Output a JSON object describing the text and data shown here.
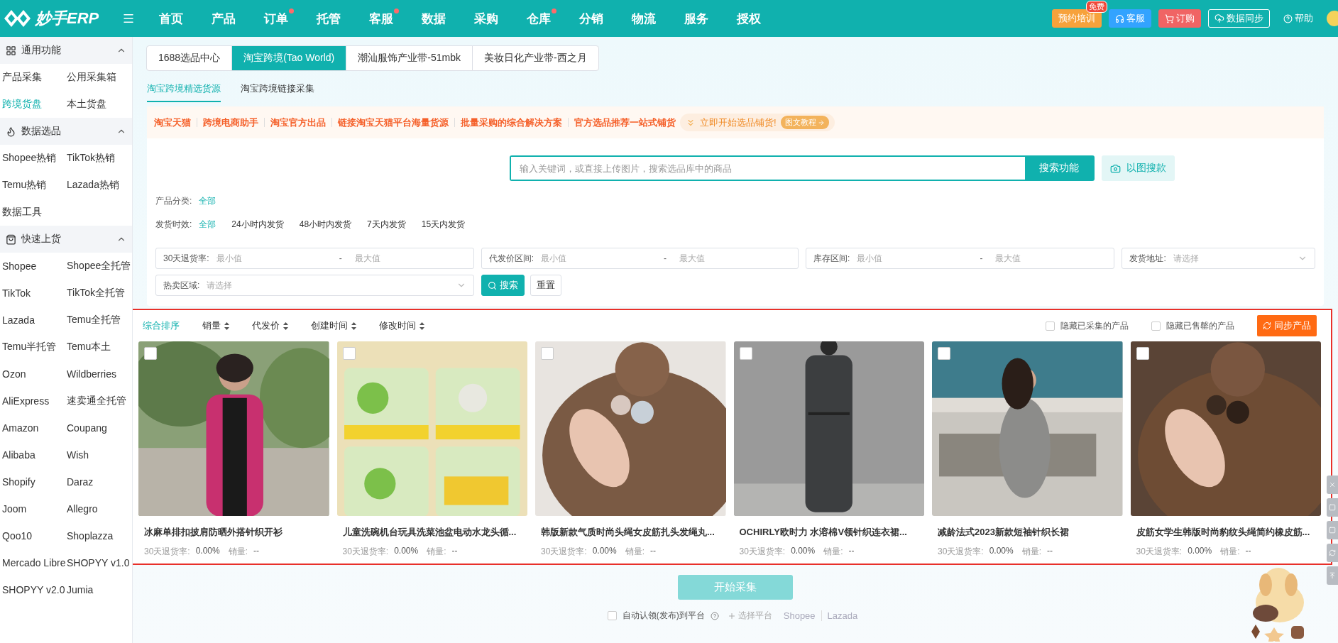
{
  "header": {
    "logo": "妙手ERP",
    "nav": [
      {
        "label": "首页",
        "dot": false
      },
      {
        "label": "产品",
        "dot": false
      },
      {
        "label": "订单",
        "dot": true
      },
      {
        "label": "托管",
        "dot": false
      },
      {
        "label": "客服",
        "dot": true
      },
      {
        "label": "数据",
        "dot": false
      },
      {
        "label": "采购",
        "dot": false
      },
      {
        "label": "仓库",
        "dot": true
      },
      {
        "label": "分销",
        "dot": false
      },
      {
        "label": "物流",
        "dot": false
      },
      {
        "label": "服务",
        "dot": false
      },
      {
        "label": "授权",
        "dot": false
      }
    ],
    "actions": [
      {
        "kind": "training",
        "label": "预约培训",
        "badge": "免费"
      },
      {
        "kind": "service",
        "label": "客服"
      },
      {
        "kind": "order",
        "label": "订购"
      },
      {
        "kind": "sync",
        "label": "数据同步"
      },
      {
        "kind": "help",
        "label": "帮助"
      }
    ]
  },
  "sidebar": {
    "sections": [
      {
        "kind": "grid",
        "title": "通用功能",
        "expanded": true,
        "items": [
          {
            "label": "产品采集",
            "selected": false
          },
          {
            "label": "公用采集箱",
            "selected": false
          },
          {
            "label": "跨境货盘",
            "selected": true
          },
          {
            "label": "本土货盘",
            "selected": false
          }
        ]
      },
      {
        "kind": "fire",
        "title": "数据选品",
        "expanded": true,
        "items": [
          {
            "label": "Shopee热销",
            "selected": false
          },
          {
            "label": "TikTok热销",
            "selected": false
          },
          {
            "label": "Temu热销",
            "selected": false
          },
          {
            "label": "Lazada热销",
            "selected": false
          },
          {
            "label": "数据工具",
            "selected": false
          }
        ]
      },
      {
        "kind": "bag",
        "title": "快速上货",
        "expanded": true,
        "items": [
          {
            "label": "Shopee",
            "selected": false
          },
          {
            "label": "Shopee全托管",
            "selected": false
          },
          {
            "label": "TikTok",
            "selected": false
          },
          {
            "label": "TikTok全托管",
            "selected": false
          },
          {
            "label": "Lazada",
            "selected": false
          },
          {
            "label": "Temu全托管",
            "selected": false
          },
          {
            "label": "Temu半托管",
            "selected": false
          },
          {
            "label": "Temu本土",
            "selected": false
          },
          {
            "label": "Ozon",
            "selected": false
          },
          {
            "label": "Wildberries",
            "selected": false
          },
          {
            "label": "AliExpress",
            "selected": false
          },
          {
            "label": "速卖通全托管",
            "selected": false
          },
          {
            "label": "Amazon",
            "selected": false
          },
          {
            "label": "Coupang",
            "selected": false
          },
          {
            "label": "Alibaba",
            "selected": false
          },
          {
            "label": "Wish",
            "selected": false
          },
          {
            "label": "Shopify",
            "selected": false
          },
          {
            "label": "Daraz",
            "selected": false
          },
          {
            "label": "Joom",
            "selected": false
          },
          {
            "label": "Allegro",
            "selected": false
          },
          {
            "label": "Qoo10",
            "selected": false
          },
          {
            "label": "Shoplazza",
            "selected": false
          },
          {
            "label": "Mercado Libre",
            "selected": false
          },
          {
            "label": "SHOPYY v1.0",
            "selected": false
          },
          {
            "label": "SHOPYY v2.0",
            "selected": false
          },
          {
            "label": "Jumia",
            "selected": false
          }
        ]
      }
    ]
  },
  "source_tabs": [
    {
      "label": "1688选品中心",
      "selected": false
    },
    {
      "label": "淘宝跨境(Tao World)",
      "selected": true
    },
    {
      "label": "潮汕服饰产业带-51mbk",
      "selected": false
    },
    {
      "label": "美妆日化产业带-西之月",
      "selected": false
    }
  ],
  "sub_tabs": [
    {
      "label": "淘宝跨境精选货源",
      "selected": true
    },
    {
      "label": "淘宝跨境链接采集",
      "selected": false
    }
  ],
  "banner": {
    "highlights": [
      "淘宝天猫",
      "跨境电商助手",
      "淘宝官方出品",
      "链接淘宝天猫平台海量货源",
      "批量采购的综合解决方案",
      "官方选品推荐一站式铺货"
    ],
    "promo": "立即开始选品铺货!",
    "tutorial": "图文教程"
  },
  "search": {
    "placeholder": "输入关键词，或直接上传图片，搜索选品库中的商品",
    "button": "搜索功能",
    "image_search": "以图搜款"
  },
  "filters": [
    {
      "label": "产品分类:",
      "options": [
        {
          "label": "全部",
          "selected": true
        }
      ]
    },
    {
      "label": "发货时效:",
      "options": [
        {
          "label": "全部",
          "selected": true
        },
        {
          "label": "24小时内发货",
          "selected": false
        },
        {
          "label": "48小时内发货",
          "selected": false
        },
        {
          "label": "7天内发货",
          "selected": false
        },
        {
          "label": "15天内发货",
          "selected": false
        }
      ]
    }
  ],
  "fields": [
    {
      "kind": "range",
      "label": "30天退货率:",
      "min_placeholder": "最小值",
      "separator": "-",
      "max_placeholder": "最大值"
    },
    {
      "kind": "range",
      "label": "代发价区间:",
      "min_placeholder": "最小值",
      "separator": "-",
      "max_placeholder": "最大值"
    },
    {
      "kind": "range",
      "label": "库存区间:",
      "min_placeholder": "最小值",
      "separator": "-",
      "max_placeholder": "最大值"
    },
    {
      "kind": "select",
      "label": "发货地址:",
      "placeholder": "请选择"
    },
    {
      "kind": "select",
      "label": "热卖区域:",
      "placeholder": "请选择"
    }
  ],
  "filter_buttons": {
    "search": "搜索",
    "reset": "重置"
  },
  "sort": [
    {
      "label": "综合排序",
      "selected": true,
      "sortable": false
    },
    {
      "label": "销量",
      "selected": false,
      "sortable": true
    },
    {
      "label": "代发价",
      "selected": false,
      "sortable": true
    },
    {
      "label": "创建时间",
      "selected": false,
      "sortable": true
    },
    {
      "label": "修改时间",
      "selected": false,
      "sortable": true
    }
  ],
  "hide_options": [
    {
      "label": "隐藏已采集的产品",
      "checked": false
    },
    {
      "label": "隐藏已售罄的产品",
      "checked": false
    }
  ],
  "sync_button": "同步产品",
  "products": [
    {
      "title": "冰麻单排扣披肩防晒外搭针织开衫",
      "return_label": "30天退货率:",
      "return_rate": "0.00%",
      "sales_label": "销量:",
      "sales": "--",
      "checked": false
    },
    {
      "title": "儿童洗碗机台玩具洗菜池盆电动水龙头循...",
      "return_label": "30天退货率:",
      "return_rate": "0.00%",
      "sales_label": "销量:",
      "sales": "--",
      "checked": false
    },
    {
      "title": "韩版新款气质时尚头绳女皮筋扎头发绳丸...",
      "return_label": "30天退货率:",
      "return_rate": "0.00%",
      "sales_label": "销量:",
      "sales": "--",
      "checked": false
    },
    {
      "title": "OCHIRLY欧时力 水溶棉V领针织连衣裙...",
      "return_label": "30天退货率:",
      "return_rate": "0.00%",
      "sales_label": "销量:",
      "sales": "--",
      "checked": false
    },
    {
      "title": "减龄法式2023新款短袖针织长裙",
      "return_label": "30天退货率:",
      "return_rate": "0.00%",
      "sales_label": "销量:",
      "sales": "--",
      "checked": false
    },
    {
      "title": "皮筋女学生韩版时尚豹纹头绳简约橡皮筋...",
      "return_label": "30天退货率:",
      "return_rate": "0.00%",
      "sales_label": "销量:",
      "sales": "--",
      "checked": false
    }
  ],
  "footer": {
    "start_button": "开始采集",
    "auto_publish": {
      "label": "自动认领(发布)到平台",
      "checked": false
    },
    "choose_platform": "选择平台",
    "platforms": [
      "Shopee",
      "Lazada"
    ]
  }
}
